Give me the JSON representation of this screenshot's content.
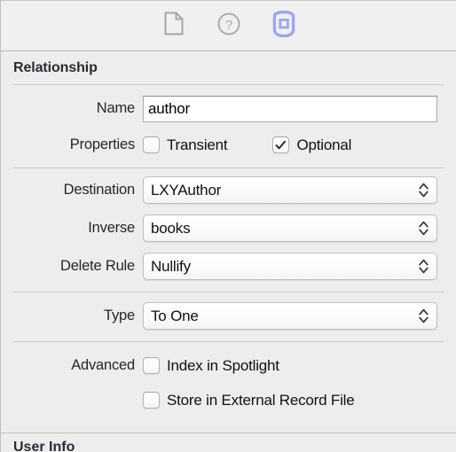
{
  "toolbar": {
    "buttons": [
      {
        "name": "file-inspector",
        "icon": "document-icon",
        "selected": false
      },
      {
        "name": "quick-help-inspector",
        "icon": "question-circle-icon",
        "selected": false
      },
      {
        "name": "data-model-inspector",
        "icon": "entity-badge-icon",
        "selected": true
      }
    ],
    "selected_color": "#9aa8f2"
  },
  "inspector": {
    "section_title": "Relationship",
    "name_row": {
      "label": "Name",
      "value": "author",
      "placeholder": "Name"
    },
    "properties_row": {
      "label": "Properties",
      "checkboxes": [
        {
          "label": "Transient",
          "checked": false
        },
        {
          "label": "Optional",
          "checked": true
        }
      ]
    },
    "destination_row": {
      "label": "Destination",
      "value": "LXYAuthor"
    },
    "inverse_row": {
      "label": "Inverse",
      "value": "books"
    },
    "delete_rule_row": {
      "label": "Delete Rule",
      "value": "Nullify"
    },
    "type_row": {
      "label": "Type",
      "value": "To One"
    },
    "advanced_row": {
      "label": "Advanced",
      "checkboxes": [
        {
          "label": "Index in Spotlight",
          "checked": false
        },
        {
          "label": "Store in External Record File",
          "checked": false
        }
      ]
    },
    "next_section_title": "User Info"
  }
}
